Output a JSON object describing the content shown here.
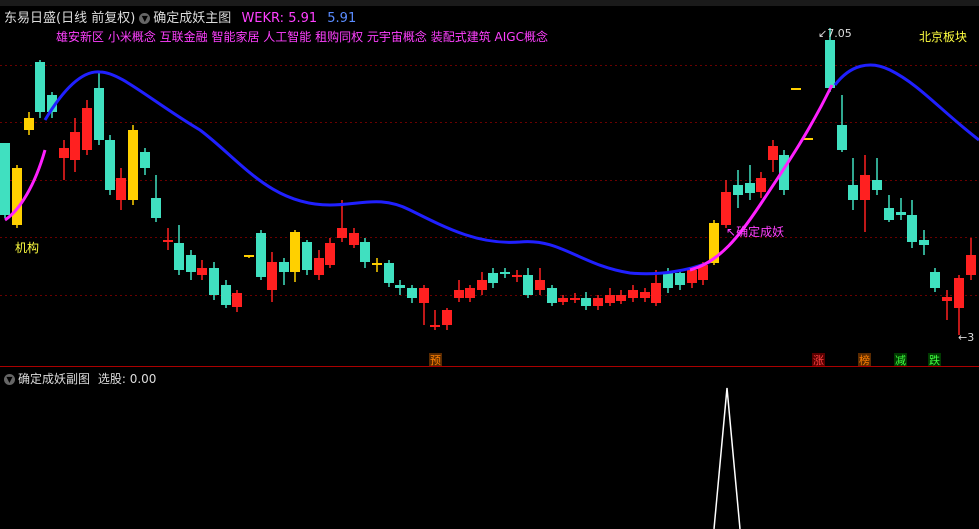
{
  "header": {
    "stock_name": "东易日盛",
    "period": "(日线 前复权)",
    "main_indicator": "确定成妖主图",
    "wekr_label": "WEKR: 5.91",
    "wekr_value2": "5.91"
  },
  "concepts": "雄安新区 小米概念 互联金融 智能家居 人工智能 租购同权 元宇宙概念 装配式建筑 AIGC概念",
  "board": "北京板块",
  "annotations": {
    "jigou": "机构",
    "queding": "确定成妖",
    "high": "7.05",
    "low": "3",
    "yu": "预",
    "zhang": "涨",
    "bang": "榜",
    "jian": "减",
    "die": "跌"
  },
  "sub": {
    "title": "确定成妖副图",
    "selection": "选股: 0.00"
  },
  "colors": {
    "up": "#ff2020",
    "down": "#40e0c0",
    "yellow": "#ffd000",
    "ma_blue": "#2020ff",
    "ma_mag": "#ff20ff",
    "grid": "#6a0000"
  }
}
